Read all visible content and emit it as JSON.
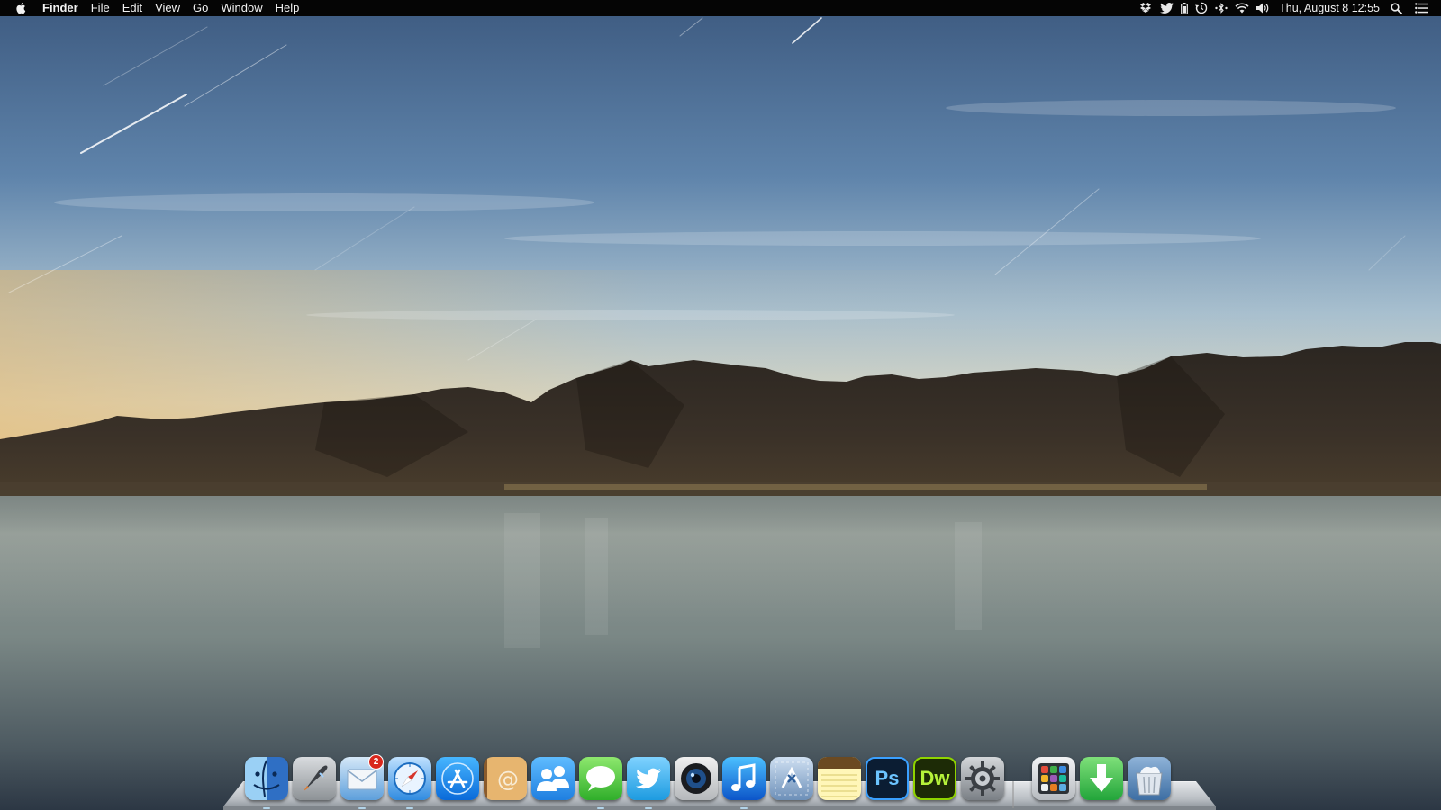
{
  "menubar": {
    "app_name": "Finder",
    "menus": [
      "File",
      "Edit",
      "View",
      "Go",
      "Window",
      "Help"
    ],
    "clock": "Thu, August 8  12:55",
    "status_icons": [
      "dropbox-icon",
      "twitter-icon",
      "battery-icon",
      "time-machine-icon",
      "bluetooth-icon",
      "wifi-icon",
      "volume-icon",
      "spotlight-search-icon",
      "notification-center-icon"
    ]
  },
  "dock": {
    "apps": [
      {
        "id": "finder",
        "icon": "finder-icon"
      },
      {
        "id": "launchpad",
        "icon": "launchpad-icon"
      },
      {
        "id": "mail",
        "icon": "mail-icon",
        "badge": "2"
      },
      {
        "id": "safari",
        "icon": "safari-icon"
      },
      {
        "id": "app-store",
        "icon": "app-store-icon"
      },
      {
        "id": "contacts",
        "icon": "contacts-icon"
      },
      {
        "id": "facetime-contacts",
        "icon": "people-icon"
      },
      {
        "id": "messages",
        "icon": "messages-icon"
      },
      {
        "id": "twitter",
        "icon": "twitter-icon"
      },
      {
        "id": "camera",
        "icon": "camera-icon"
      },
      {
        "id": "itunes",
        "icon": "itunes-icon"
      },
      {
        "id": "migration",
        "icon": "migration-assistant-icon"
      },
      {
        "id": "notes",
        "icon": "notes-icon"
      },
      {
        "id": "photoshop",
        "icon": "photoshop-icon",
        "label": "Ps"
      },
      {
        "id": "dreamweaver",
        "icon": "dreamweaver-icon",
        "label": "Dw"
      },
      {
        "id": "system-preferences",
        "icon": "gear-icon"
      }
    ],
    "stacks": [
      {
        "id": "applications",
        "icon": "applications-stack-icon"
      },
      {
        "id": "downloads",
        "icon": "downloads-icon"
      },
      {
        "id": "trash",
        "icon": "trash-icon"
      }
    ]
  },
  "colors": {
    "sky_top": "#3f5c82",
    "sky_horizon": "#e8cfa0",
    "mountains": "#2a241e",
    "water": "#6f7d7f",
    "mail_badge": "#d9261c"
  }
}
